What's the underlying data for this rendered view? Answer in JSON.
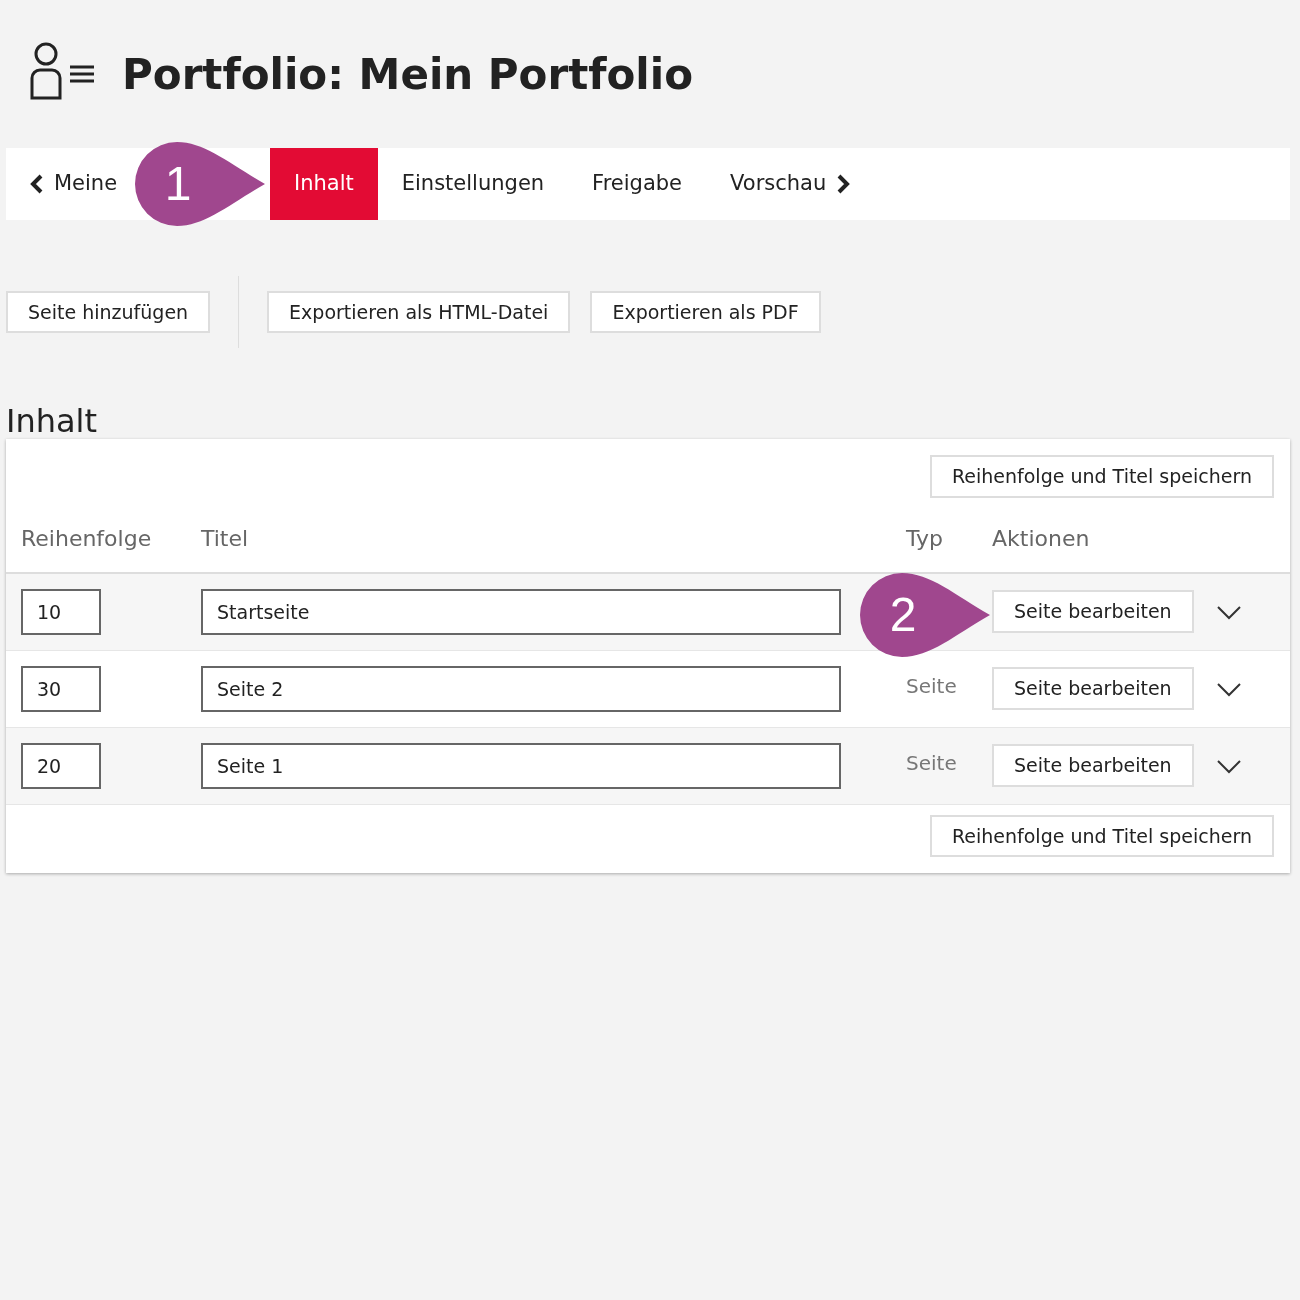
{
  "page": {
    "title": "Portfolio: Mein Portfolio"
  },
  "tabs": [
    {
      "label": "Meine",
      "kind": "back",
      "selected": false
    },
    {
      "label": "Inhalt",
      "kind": "plain",
      "selected": true
    },
    {
      "label": "Einstellungen",
      "kind": "plain",
      "selected": false
    },
    {
      "label": "Freigabe",
      "kind": "plain",
      "selected": false
    },
    {
      "label": "Vorschau",
      "kind": "forward",
      "selected": false
    }
  ],
  "toolbar": {
    "buttons": [
      "Seite hinzufügen",
      "Exportieren als HTML-Datei",
      "Exportieren als PDF"
    ]
  },
  "section": {
    "heading": "Inhalt",
    "top_button": "Reihenfolge und Titel speichern",
    "bottom_button": "Reihenfolge und Titel speichern"
  },
  "table": {
    "columns": [
      "Reihenfolge",
      "Titel",
      "Typ",
      "Aktionen"
    ],
    "rows": [
      {
        "order": "10",
        "title": "Startseite",
        "action": "Seite bearbeiten"
      },
      {
        "order": "30",
        "title": "Seite 2",
        "type": "Seite",
        "action": "Seite bearbeiten"
      },
      {
        "order": "20",
        "title": "Seite 1",
        "type": "Seite",
        "action": "Seite bearbeiten"
      }
    ]
  },
  "callouts": [
    {
      "number": "1"
    },
    {
      "number": "2"
    }
  ]
}
